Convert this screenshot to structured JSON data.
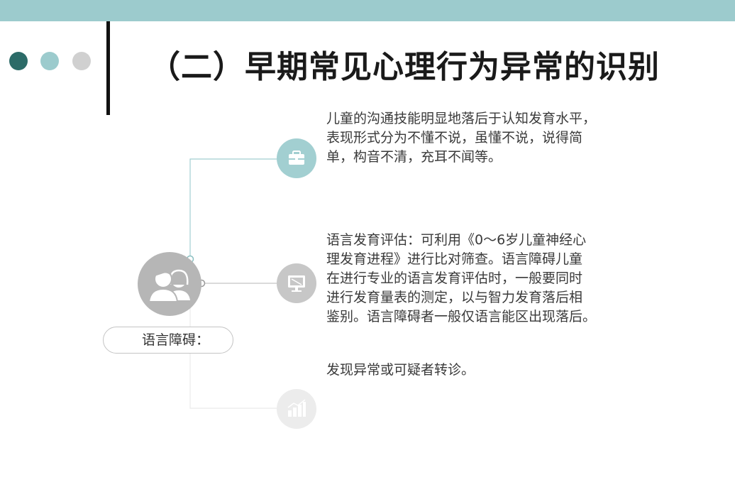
{
  "title": "（二）早期常见心理行为异常的识别",
  "category_label": "语言障碍：",
  "items": [
    {
      "icon": "briefcase-icon",
      "lines": [
        "儿童的沟通技能明显地落后于认知发育水平，",
        "表现形式分为不懂不说，虽懂不说，说得简",
        "单，构音不清，充耳不闻等。"
      ]
    },
    {
      "icon": "monitor-icon",
      "lines": [
        "语言发育评估：可利用《0～6岁儿童神经心",
        "理发育进程》进行比对筛查。语言障碍儿童",
        "在进行专业的语言发育评估时，一般要同时",
        "进行发育量表的测定，以与智力发育落后相",
        "鉴别。语言障碍者一般仅语言能区出现落后。"
      ]
    },
    {
      "icon": "chart-icon",
      "lines": [
        "发现异常或可疑者转诊。"
      ]
    }
  ],
  "colors": {
    "band": "#9ccbcd",
    "dot_dark": "#2c6b68",
    "dot_light": "#9ccbcd",
    "dot_gray": "#d0d0d0"
  }
}
